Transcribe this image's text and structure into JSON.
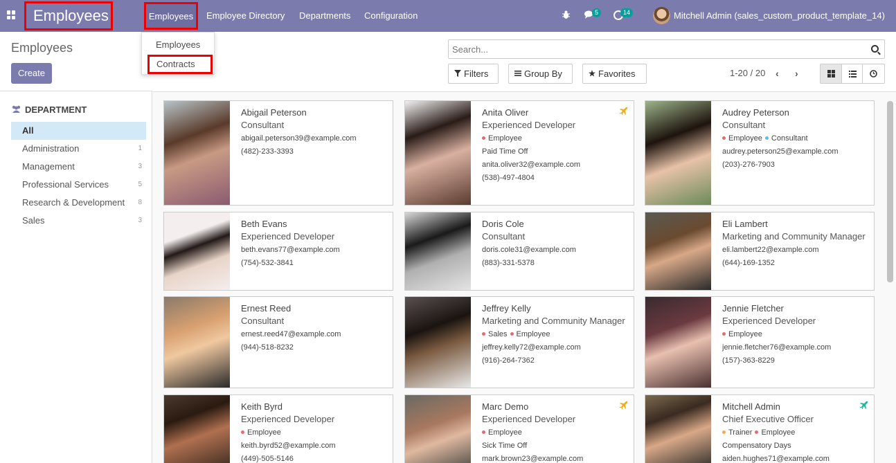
{
  "navbar": {
    "app_title": "Employees",
    "menu": [
      {
        "label": "Employees",
        "active": true
      },
      {
        "label": "Employee Directory"
      },
      {
        "label": "Departments"
      },
      {
        "label": "Configuration"
      }
    ],
    "chat_badge": "5",
    "activity_badge": "14",
    "user_name": "Mitchell Admin (sales_custom_product_template_14)"
  },
  "dropdown": {
    "items": [
      "Employees",
      "Contracts"
    ]
  },
  "control_panel": {
    "title": "Employees",
    "create_label": "Create",
    "search_placeholder": "Search...",
    "filters_label": "Filters",
    "group_by_label": "Group By",
    "favorites_label": "Favorites",
    "pager": "1-20 / 20"
  },
  "sidebar": {
    "title": "DEPARTMENT",
    "items": [
      {
        "label": "All",
        "count": ""
      },
      {
        "label": "Administration",
        "count": "1"
      },
      {
        "label": "Management",
        "count": "3"
      },
      {
        "label": "Professional Services",
        "count": "5"
      },
      {
        "label": "Research & Development",
        "count": "8"
      },
      {
        "label": "Sales",
        "count": "3"
      }
    ]
  },
  "colors": {
    "brand": "#7c7bad",
    "highlight_red": "#e00000",
    "tag_employee": "#e06c75",
    "tag_consultant": "#5bc0de",
    "tag_sales": "#e06c75",
    "tag_trainer": "#f0ad4e",
    "leave_yellow": "#f0ad1e",
    "leave_green": "#21b799"
  },
  "employees": [
    {
      "name": "Abigail Peterson",
      "job": "Consultant",
      "tags": [],
      "extra": "",
      "email": "abigail.peterson39@example.com",
      "phone": "(482)-233-3393",
      "icon": ""
    },
    {
      "name": "Anita Oliver",
      "job": "Experienced Developer",
      "tags": [
        "Employee"
      ],
      "extra": "Paid Time Off",
      "email": "anita.oliver32@example.com",
      "phone": "(538)-497-4804",
      "icon": "plane-yellow"
    },
    {
      "name": "Audrey Peterson",
      "job": "Consultant",
      "tags": [
        "Employee",
        "Consultant"
      ],
      "extra": "",
      "email": "audrey.peterson25@example.com",
      "phone": "(203)-276-7903",
      "icon": ""
    },
    {
      "name": "Beth Evans",
      "job": "Experienced Developer",
      "tags": [],
      "extra": "",
      "email": "beth.evans77@example.com",
      "phone": "(754)-532-3841",
      "icon": ""
    },
    {
      "name": "Doris Cole",
      "job": "Consultant",
      "tags": [],
      "extra": "",
      "email": "doris.cole31@example.com",
      "phone": "(883)-331-5378",
      "icon": ""
    },
    {
      "name": "Eli Lambert",
      "job": "Marketing and Community Manager",
      "tags": [],
      "extra": "",
      "email": "eli.lambert22@example.com",
      "phone": "(644)-169-1352",
      "icon": ""
    },
    {
      "name": "Ernest Reed",
      "job": "Consultant",
      "tags": [],
      "extra": "",
      "email": "ernest.reed47@example.com",
      "phone": "(944)-518-8232",
      "icon": ""
    },
    {
      "name": "Jeffrey Kelly",
      "job": "Marketing and Community Manager",
      "tags": [
        "Sales",
        "Employee"
      ],
      "extra": "",
      "email": "jeffrey.kelly72@example.com",
      "phone": "(916)-264-7362",
      "icon": ""
    },
    {
      "name": "Jennie Fletcher",
      "job": "Experienced Developer",
      "tags": [
        "Employee"
      ],
      "extra": "",
      "email": "jennie.fletcher76@example.com",
      "phone": "(157)-363-8229",
      "icon": ""
    },
    {
      "name": "Keith Byrd",
      "job": "Experienced Developer",
      "tags": [
        "Employee"
      ],
      "extra": "",
      "email": "keith.byrd52@example.com",
      "phone": "(449)-505-5146",
      "icon": ""
    },
    {
      "name": "Marc Demo",
      "job": "Experienced Developer",
      "tags": [
        "Employee"
      ],
      "extra": "Sick Time Off",
      "email": "mark.brown23@example.com",
      "phone": "",
      "icon": "plane-yellow"
    },
    {
      "name": "Mitchell Admin",
      "job": "Chief Executive Officer",
      "tags": [
        "Trainer",
        "Employee"
      ],
      "extra": "Compensatory Days",
      "email": "aiden.hughes71@example.com",
      "phone": "",
      "icon": "plane-green"
    }
  ]
}
